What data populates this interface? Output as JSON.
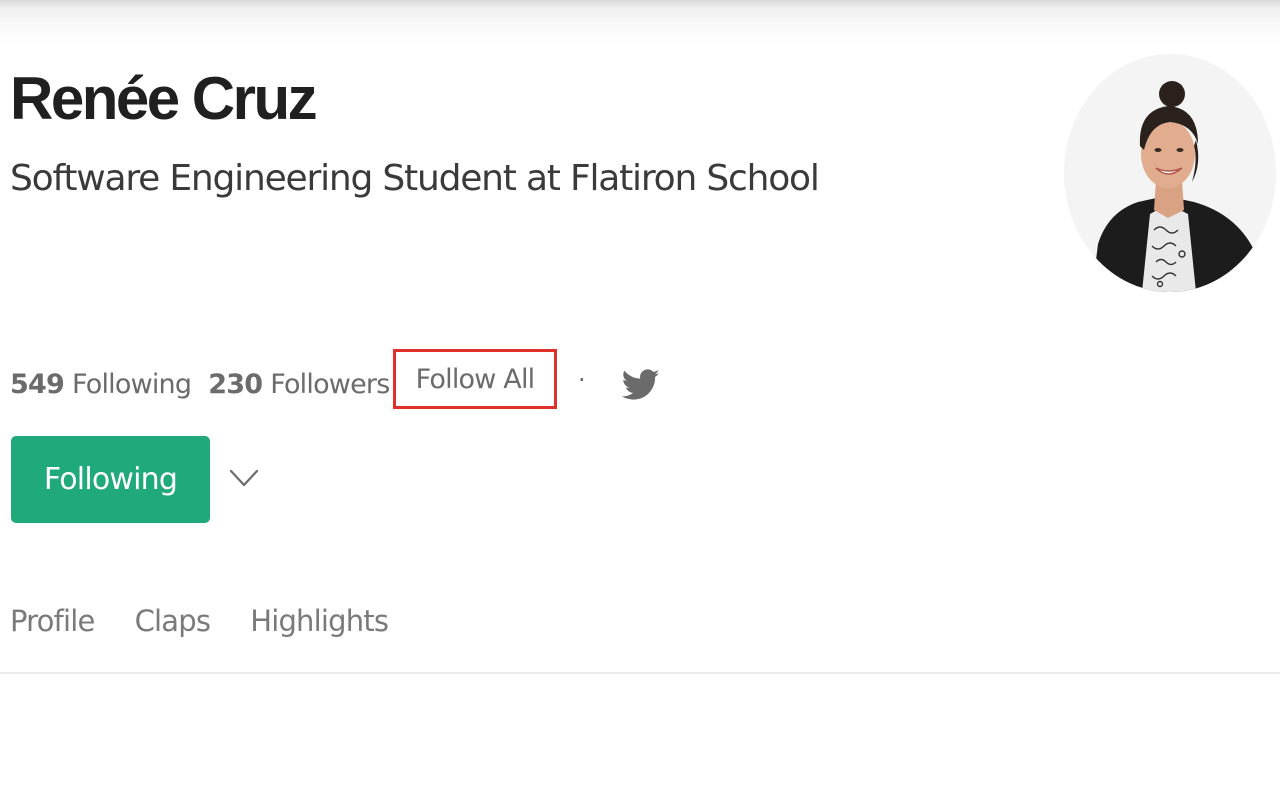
{
  "profile": {
    "name": "Renée Cruz",
    "bio": "Software Engineering Student at Flatiron School"
  },
  "stats": {
    "following_count": "549",
    "following_label": "Following",
    "followers_count": "230",
    "followers_label": "Followers",
    "follow_all_label": "Follow All",
    "separator": "·",
    "social_icon": "twitter-icon"
  },
  "actions": {
    "following_button_label": "Following",
    "menu_icon": "chevron-down-icon"
  },
  "tabs": [
    {
      "label": "Profile"
    },
    {
      "label": "Claps"
    },
    {
      "label": "Highlights"
    }
  ],
  "colors": {
    "accent": "#20a97a",
    "highlight_box": "#e0302a",
    "muted_text": "#6b6b6b"
  }
}
